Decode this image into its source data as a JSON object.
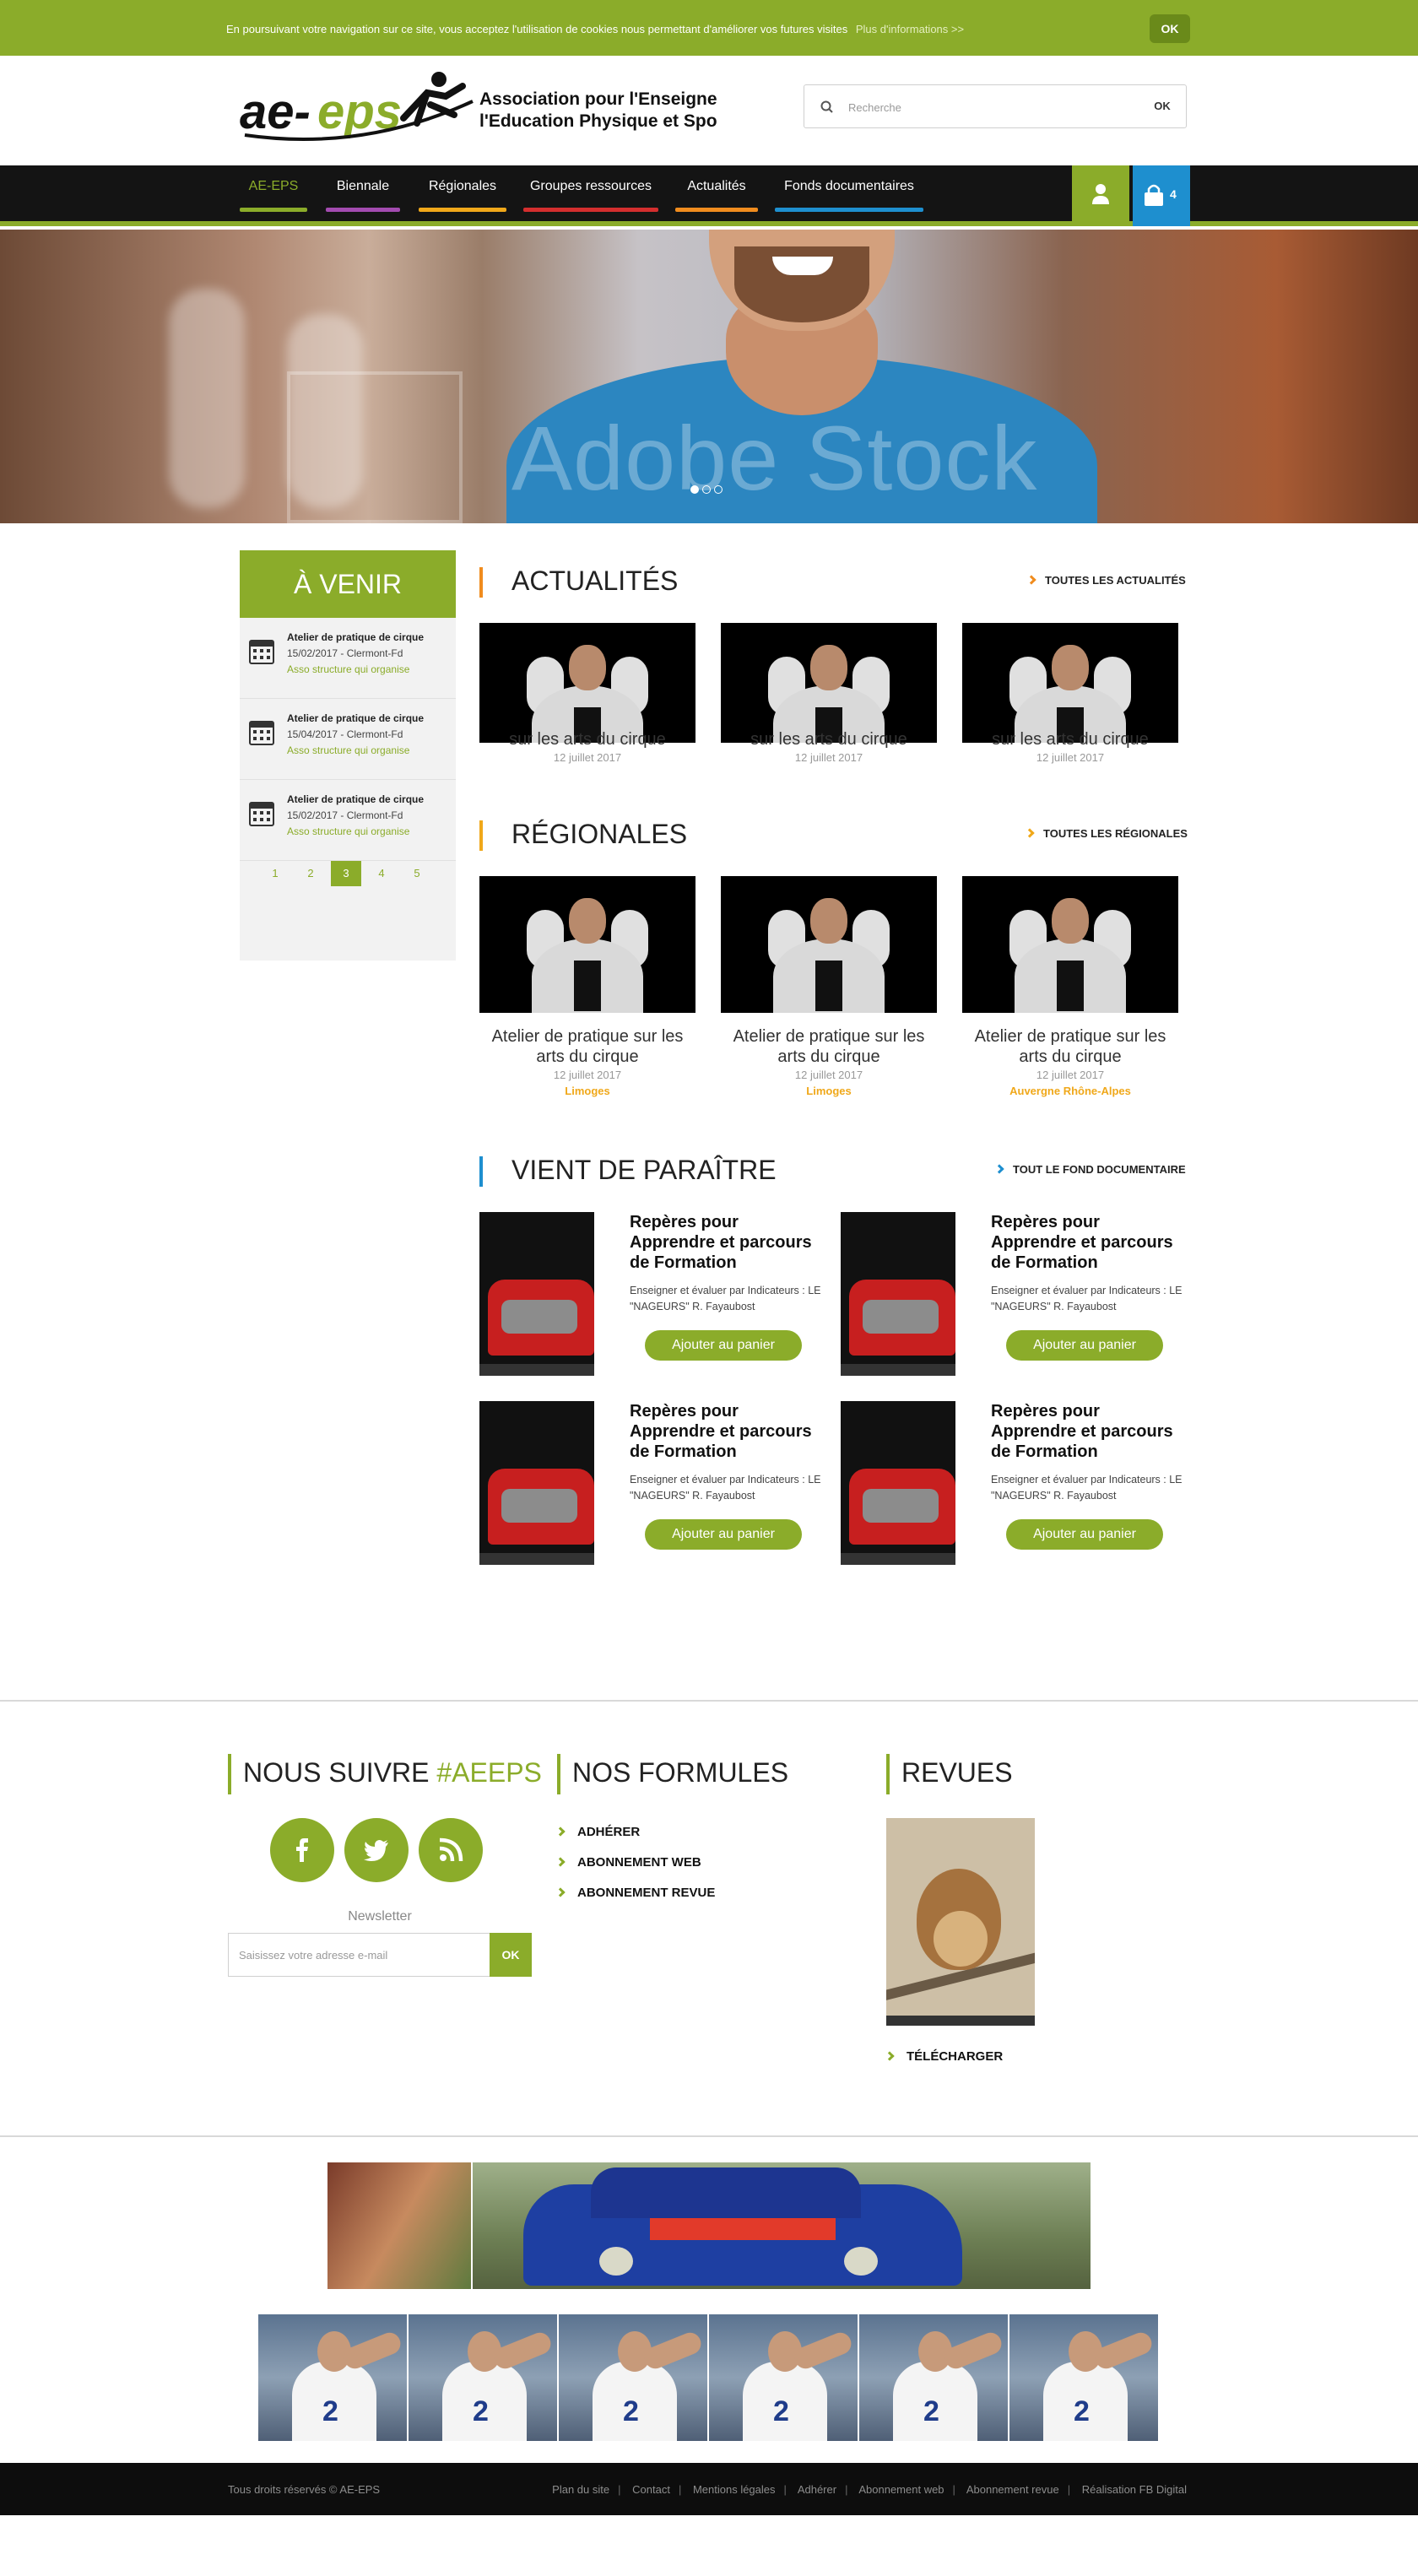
{
  "colors": {
    "brand_green": "#8bac2a",
    "dark": "#141414",
    "blue": "#1e8fcf",
    "orange": "#f08c1e",
    "yellow": "#f0a81a"
  },
  "cookie": {
    "message": "En poursuivant votre navigation sur ce site, vous acceptez l'utilisation de cookies nous permettant d'améliorer vos futures visites",
    "more": "Plus d'informations >>",
    "ok": "OK"
  },
  "header": {
    "logo_text": "AE-EPS",
    "logo_line1": "Association pour l'Enseignement",
    "logo_line2": "l'Education Physique et Sportive",
    "search_placeholder": "Recherche",
    "search_button": "OK"
  },
  "nav": {
    "items": [
      {
        "label": "AE-EPS",
        "color": "#8bac2a",
        "active": true
      },
      {
        "label": "Biennale",
        "color": "#a34bb0"
      },
      {
        "label": "Régionales",
        "color": "#f0a81a"
      },
      {
        "label": "Groupes ressources",
        "color": "#d42e2e"
      },
      {
        "label": "Actualités",
        "color": "#f08c1e"
      },
      {
        "label": "Fonds documentaires",
        "color": "#1e8fcf"
      }
    ],
    "user_icon": "user-icon",
    "cart_icon": "shopping-bag-icon",
    "cart_count": "4"
  },
  "hero": {
    "watermark": "Adobe Stock",
    "slides": 3,
    "active_slide": 1
  },
  "venir": {
    "title": "À VENIR",
    "events": [
      {
        "title": "Atelier de pratique de cirque",
        "date": "15/02/2017 - Clermont-Fd",
        "org": "Asso structure qui organise"
      },
      {
        "title": "Atelier de pratique de cirque",
        "date": "15/04/2017 - Clermont-Fd",
        "org": "Asso structure qui organise"
      },
      {
        "title": "Atelier de pratique de cirque",
        "date": "15/02/2017 - Clermont-Fd",
        "org": "Asso structure qui organise"
      }
    ],
    "pages": [
      "1",
      "2",
      "3",
      "4",
      "5"
    ],
    "current_page": "3"
  },
  "actualites": {
    "title": "ACTUALITÉS",
    "link": "TOUTES LES ACTUALITÉS",
    "items": [
      {
        "title": "sur les arts du cirque",
        "date": "12 juillet 2017"
      },
      {
        "title": "sur les arts du cirque",
        "date": "12 juillet 2017"
      },
      {
        "title": "sur les arts du cirque",
        "date": "12 juillet 2017"
      }
    ]
  },
  "regionales": {
    "title": "RÉGIONALES",
    "link": "TOUTES LES RÉGIONALES",
    "items": [
      {
        "title": "Atelier de pratique sur les arts du cirque",
        "date": "12 juillet 2017",
        "region": "Limoges"
      },
      {
        "title": "Atelier de pratique sur les arts du cirque",
        "date": "12 juillet 2017",
        "region": "Limoges"
      },
      {
        "title": "Atelier de pratique sur les arts du cirque",
        "date": "12 juillet 2017",
        "region": "Auvergne Rhône-Alpes"
      }
    ]
  },
  "paraitre": {
    "title": "VIENT DE PARAÎTRE",
    "link": "TOUT LE FOND DOCUMENTAIRE",
    "books": [
      {
        "title": "Repères pour Apprendre et parcours de Formation",
        "desc": "Enseigner et évaluer par Indicateurs : LE \"NAGEURS\" R. Fayaubost",
        "button": "Ajouter au panier"
      },
      {
        "title": "Repères pour Apprendre et parcours de Formation",
        "desc": "Enseigner et évaluer par Indicateurs : LE \"NAGEURS\" R. Fayaubost",
        "button": "Ajouter au panier"
      },
      {
        "title": "Repères pour Apprendre et parcours de Formation",
        "desc": "Enseigner et évaluer par Indicateurs : LE \"NAGEURS\" R. Fayaubost",
        "button": "Ajouter au panier"
      },
      {
        "title": "Repères pour Apprendre et parcours de Formation",
        "desc": "Enseigner et évaluer par Indicateurs : LE \"NAGEURS\" R. Fayaubost",
        "button": "Ajouter au panier"
      }
    ]
  },
  "footer": {
    "follow_title": "NOUS SUIVRE ",
    "follow_hashtag": "#AEEPS",
    "social": [
      "facebook-icon",
      "twitter-icon",
      "rss-icon"
    ],
    "newsletter_label": "Newsletter",
    "newsletter_placeholder": "Saisissez votre adresse e-mail",
    "newsletter_button": "OK",
    "formules_title": "NOS FORMULES",
    "formules": [
      "ADHÉRER",
      "ABONNEMENT WEB",
      "ABONNEMENT REVUE"
    ],
    "revues_title": "REVUES",
    "download": "TÉLÉCHARGER"
  },
  "bottom": {
    "copyright": "Tous droits réservés © AE-EPS",
    "links": [
      "Plan du site",
      "Contact",
      "Mentions légales",
      "Adhérer",
      "Abonnement web",
      "Abonnement revue",
      "Réalisation FB Digital"
    ]
  }
}
